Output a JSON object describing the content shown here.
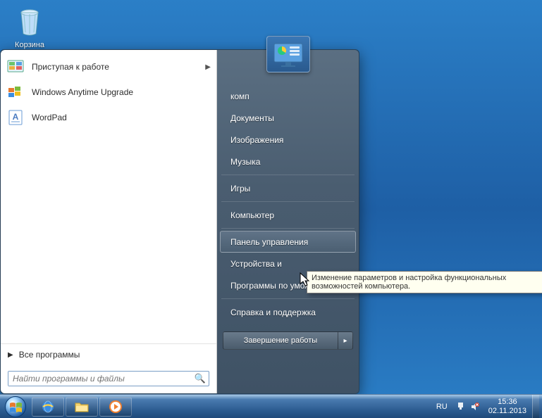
{
  "desktop": {
    "recycle_bin_label": "Корзина"
  },
  "start_menu": {
    "programs": [
      {
        "label": "Приступая к работе",
        "has_arrow": true
      },
      {
        "label": "Windows Anytime Upgrade",
        "has_arrow": false
      },
      {
        "label": "WordPad",
        "has_arrow": false
      }
    ],
    "all_programs_label": "Все программы",
    "search_placeholder": "Найти программы и файлы",
    "right_items": [
      {
        "label": "комп",
        "sep_after": false
      },
      {
        "label": "Документы",
        "sep_after": false
      },
      {
        "label": "Изображения",
        "sep_after": false
      },
      {
        "label": "Музыка",
        "sep_after": true
      },
      {
        "label": "Игры",
        "sep_after": true
      },
      {
        "label": "Компьютер",
        "sep_after": true
      },
      {
        "label": "Панель управления",
        "highlight": true,
        "sep_after": false
      },
      {
        "label": "Устройства и принтеры",
        "truncated": "Устройства и",
        "sep_after": false
      },
      {
        "label": "Программы по умолчанию",
        "sep_after": true
      },
      {
        "label": "Справка и поддержка",
        "sep_after": false
      }
    ],
    "shutdown_label": "Завершение работы"
  },
  "tooltip_text": "Изменение параметров и настройка функциональных возможностей компьютера.",
  "taskbar": {
    "buttons": [
      "internet-explorer",
      "file-explorer",
      "media-player"
    ],
    "language": "RU",
    "time": "15:36",
    "date": "02.11.2013"
  }
}
